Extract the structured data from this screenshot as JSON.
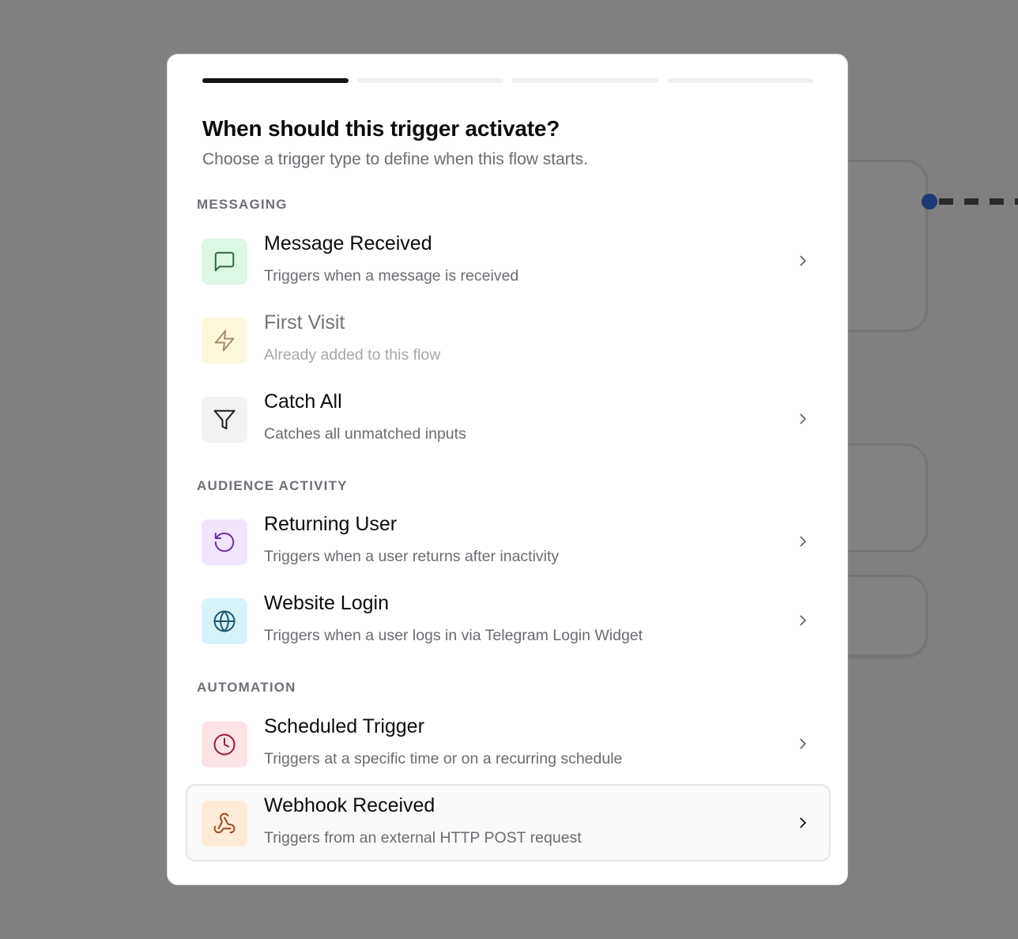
{
  "wizard": {
    "total_steps": 4,
    "current_step": 1,
    "title": "When should this trigger activate?",
    "subtitle": "Choose a trigger type to define when this flow starts."
  },
  "sections": [
    {
      "label": "MESSAGING",
      "items": [
        {
          "name": "Message Received",
          "desc": "Triggers when a message is received",
          "icon": "message-square-icon",
          "icon_color": "#2e6b3a",
          "icon_bg": "#dcf7e3",
          "disabled": false
        },
        {
          "name": "First Visit",
          "desc": "Already added to this flow",
          "icon": "lightning-bolt-icon",
          "icon_color": "#a78b6b",
          "icon_bg": "#fdf8dc",
          "disabled": true
        },
        {
          "name": "Catch All",
          "desc": "Catches all unmatched inputs",
          "icon": "filter-icon",
          "icon_color": "#1e1e1e",
          "icon_bg": "#f1f2f4",
          "disabled": false
        }
      ]
    },
    {
      "label": "AUDIENCE ACTIVITY",
      "items": [
        {
          "name": "Returning User",
          "desc": "Triggers when a user returns after inactivity",
          "icon": "rotate-ccw-icon",
          "icon_color": "#6b2fa8",
          "icon_bg": "#f0e5fb",
          "disabled": false
        },
        {
          "name": "Website Login",
          "desc": "Triggers when a user logs in via Telegram Login Widget",
          "icon": "globe-icon",
          "icon_color": "#1a5670",
          "icon_bg": "#d6f3fa",
          "disabled": false
        }
      ]
    },
    {
      "label": "AUTOMATION",
      "items": [
        {
          "name": "Scheduled Trigger",
          "desc": "Triggers at a specific time or on a recurring schedule",
          "icon": "clock-icon",
          "icon_color": "#9b1c3a",
          "icon_bg": "#fbe3e6",
          "disabled": false
        },
        {
          "name": "Webhook Received",
          "desc": "Triggers from an external HTTP POST request",
          "icon": "webhook-icon",
          "icon_color": "#a04a1c",
          "icon_bg": "#fdebd8",
          "disabled": false
        }
      ]
    }
  ]
}
